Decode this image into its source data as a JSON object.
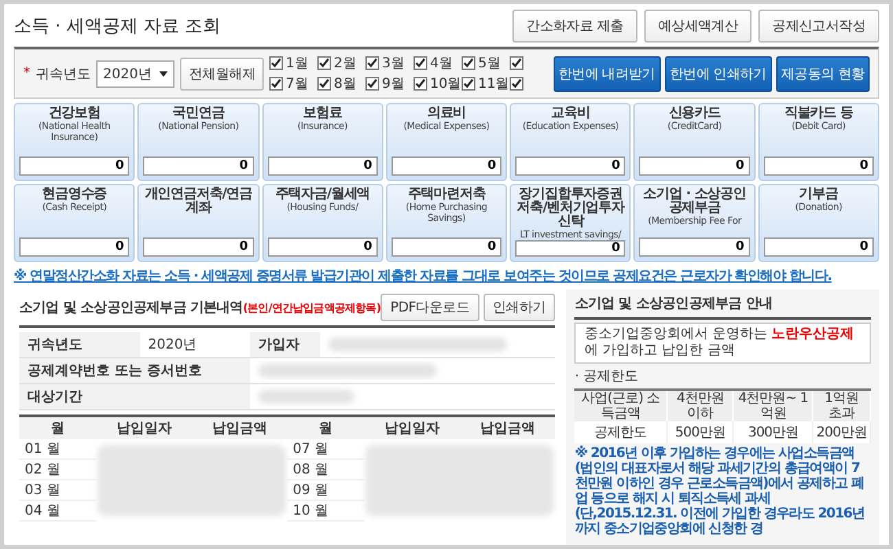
{
  "page": {
    "title": "소득 · 세액공제 자료 조회"
  },
  "top_buttons": [
    "간소화자료 제출",
    "예상세액계산",
    "공제신고서작성"
  ],
  "filter": {
    "required_mark": "*",
    "year_label": "귀속년도",
    "year_value": "2020년",
    "clear_button": "전체월해제",
    "months": [
      {
        "label": "1월",
        "checked": true
      },
      {
        "label": "2월",
        "checked": true
      },
      {
        "label": "3월",
        "checked": true
      },
      {
        "label": "4월",
        "checked": true
      },
      {
        "label": "5월",
        "checked": true
      },
      {
        "checked": true
      },
      {
        "label": "7월",
        "checked": true
      },
      {
        "label": "8월",
        "checked": true
      },
      {
        "label": "9월",
        "checked": true
      },
      {
        "label": "10월",
        "checked": true
      },
      {
        "label": "11월",
        "checked": true
      },
      {
        "checked": true
      }
    ],
    "action_buttons": [
      "한번에 내려받기",
      "한번에 인쇄하기",
      "제공동의 현황"
    ]
  },
  "cards": [
    {
      "title": "건강보험",
      "subtitle": "(National Health Insurance)",
      "value": "0"
    },
    {
      "title": "국민연금",
      "subtitle": "(National Pension)",
      "value": "0"
    },
    {
      "title": "보험료",
      "subtitle": "(Insurance)",
      "value": "0"
    },
    {
      "title": "의료비",
      "subtitle": "(Medical Expenses)",
      "value": "0"
    },
    {
      "title": "교육비",
      "subtitle": "(Education Expenses)",
      "value": "0"
    },
    {
      "title": "신용카드",
      "subtitle": "(CreditCard)",
      "value": "0"
    },
    {
      "title": "직불카드 등",
      "subtitle": "(Debit Card)",
      "value": "0"
    },
    {
      "title": "현금영수증",
      "subtitle": "(Cash Receipt)",
      "value": "0"
    },
    {
      "title": "개인연금저축/연금계좌",
      "value": "0"
    },
    {
      "title": "주택자금/월세액",
      "subtitle": "(Housing Funds/",
      "value": "0"
    },
    {
      "title": "주택마련저축",
      "subtitle": "(Home Purchasing Savings)",
      "value": "0"
    },
    {
      "title": "장기집합투자증권저축/벤처기업투자신탁",
      "subtitle": "LT investment savings/",
      "value": "0"
    },
    {
      "title": "소기업 · 소상공인 공제부금",
      "subtitle": "(Membership Fee For",
      "value": "0"
    },
    {
      "title": "기부금",
      "subtitle": "(Donation)",
      "value": "0"
    }
  ],
  "notice": "※ 연말정산간소화 자료는 소득 · 세액공제 증명서류 발급기관이 제출한 자료를 그대로 보여주는 것이므로 공제요건은 근로자가 확인해야 합니다.",
  "detail": {
    "title": "소기업 및 소상공인공제부금 기본내역",
    "title_note": "(본인/연간납입금액공제항목)",
    "buttons": [
      "PDF다운로드",
      "인쇄하기"
    ],
    "year_label": "귀속년도",
    "year_value": "2020년",
    "member_label": "가입자",
    "contract_label": "공제계약번호 또는 증서번호",
    "period_label": "대상기간",
    "columns": [
      "월",
      "납입일자",
      "납입금액",
      "월",
      "납입일자",
      "납입금액"
    ],
    "rows": [
      {
        "month_a": "01 월",
        "month_b": "07 월"
      },
      {
        "month_a": "02 월",
        "month_b": "08 월"
      },
      {
        "month_a": "03 월",
        "month_b": "09 월"
      },
      {
        "month_a": "04 월",
        "month_b": "10 월"
      }
    ]
  },
  "guide": {
    "title": "소기업 및 소상공인공제부금 안내",
    "box_text": "중소기업중앙회에서 운영하는 **노란우산공제**에 가입하고 납입한 금액",
    "limit_label": "· 공제한도",
    "table_header": [
      "사업(근로) 소득금액",
      "4천만원 이하",
      "4천만원~ 1억원",
      "1억원 초과"
    ],
    "table_row": [
      "공제한도",
      "500만원",
      "300만원",
      "200만원"
    ],
    "note": "※ 2016년 이후 가입하는 경우에는 사업소득금액(법인의 대표자로서 해당 과세기간의 총급여액이 7천만원 이하인 경우 근로소득금액)에서 공제하고 폐업 등으로 해지 시 퇴직소득세 과세 (단,2015.12.31. 이전에 가입한 경우라도 2016년까지 중소기업중앙회에 신청한 경"
  }
}
